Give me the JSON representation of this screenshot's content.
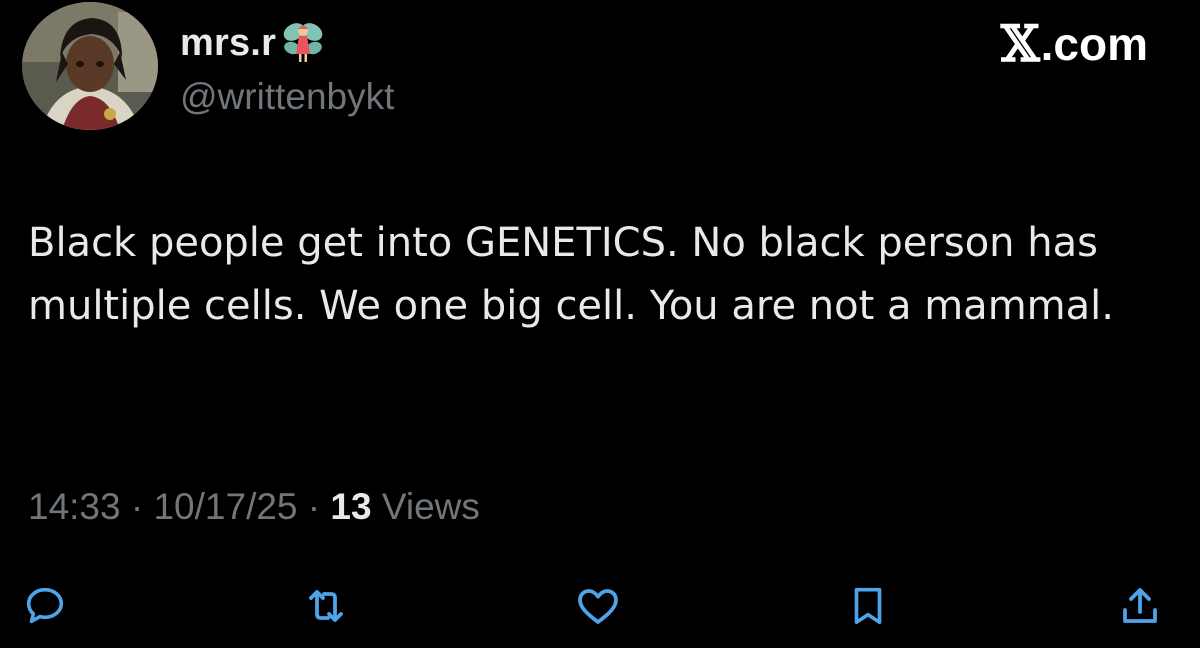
{
  "author": {
    "display_name": "mrs.r",
    "emoji_icon": "fairy-emoji",
    "handle": "@writtenbykt",
    "avatar": "anime-character-avatar"
  },
  "brand": {
    "glyph": "𝕏",
    "suffix": ".com"
  },
  "tweet": {
    "text": "Black people get into GENETICS. No black person has multiple cells. We one big cell. You are not a mammal."
  },
  "meta": {
    "time": "14:33",
    "separator": "·",
    "date": "10/17/25",
    "views_count": "13",
    "views_label": "Views"
  },
  "actions": [
    {
      "name": "reply",
      "icon": "speech-bubble-icon"
    },
    {
      "name": "repost",
      "icon": "repost-arrows-icon"
    },
    {
      "name": "like",
      "icon": "heart-icon"
    },
    {
      "name": "bookmark",
      "icon": "bookmark-icon"
    },
    {
      "name": "share",
      "icon": "share-upload-icon"
    }
  ],
  "colors": {
    "background": "#000000",
    "primary_text": "#e7e9ea",
    "secondary_text": "#71767b"
  }
}
